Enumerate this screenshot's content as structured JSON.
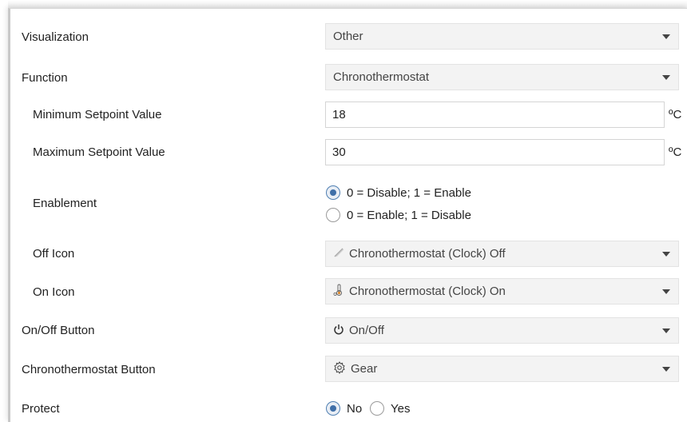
{
  "rows": {
    "visualization": {
      "label": "Visualization",
      "value": "Other"
    },
    "function": {
      "label": "Function",
      "value": "Chronothermostat"
    },
    "min_setpoint": {
      "label": "Minimum Setpoint Value",
      "value": "18",
      "unit": "ºC"
    },
    "max_setpoint": {
      "label": "Maximum Setpoint Value",
      "value": "30",
      "unit": "ºC"
    },
    "enablement": {
      "label": "Enablement",
      "options": [
        "0 = Disable; 1 = Enable",
        "0 = Enable; 1 = Disable"
      ],
      "selected": "0 = Disable; 1 = Enable"
    },
    "off_icon": {
      "label": "Off Icon",
      "value": "Chronothermostat (Clock) Off",
      "icon": "clock-off-icon"
    },
    "on_icon": {
      "label": "On Icon",
      "value": "Chronothermostat (Clock) On",
      "icon": "clock-on-icon"
    },
    "onoff_button": {
      "label": "On/Off Button",
      "value": "On/Off",
      "icon": "power-icon"
    },
    "chrono_button": {
      "label": "Chronothermostat Button",
      "value": "Gear",
      "icon": "gear-icon"
    },
    "protect": {
      "label": "Protect",
      "options": [
        "No",
        "Yes"
      ],
      "selected": "No"
    }
  },
  "colors": {
    "radio_selected": "#3f6fa8",
    "dropdown_bg": "#f3f3f3"
  }
}
